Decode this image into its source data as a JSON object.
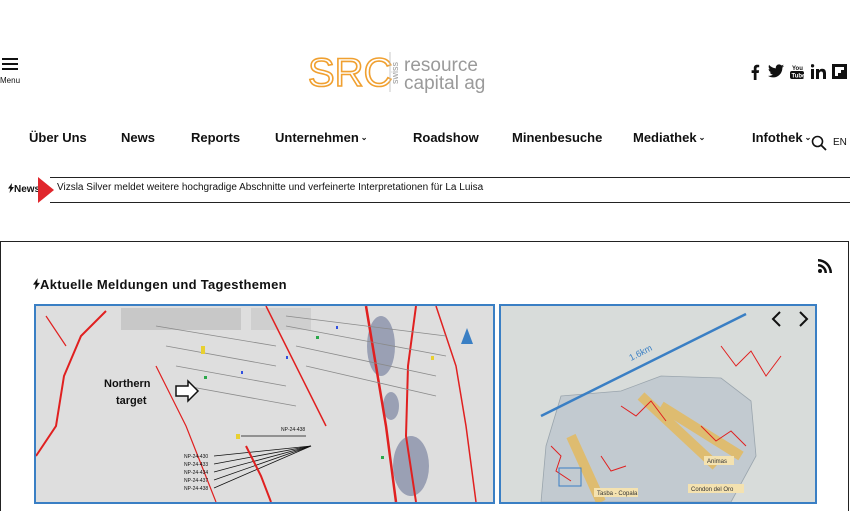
{
  "header": {
    "menu_label": "Menu",
    "logo": {
      "mark": "SRC",
      "swiss": "swiss",
      "line1": "resource",
      "line2": "capital ag"
    },
    "social": [
      "facebook-icon",
      "twitter-icon",
      "youtube-icon",
      "linkedin-icon",
      "flipboard-icon"
    ]
  },
  "nav": {
    "items": [
      {
        "label": "Über Uns",
        "has_caret": false
      },
      {
        "label": "News",
        "has_caret": false
      },
      {
        "label": "Reports",
        "has_caret": false
      },
      {
        "label": "Unternehmen",
        "has_caret": true
      },
      {
        "label": "Roadshow",
        "has_caret": false
      },
      {
        "label": "Minenbesuche",
        "has_caret": false
      },
      {
        "label": "Mediathek",
        "has_caret": true
      },
      {
        "label": "Infothek",
        "has_caret": true
      }
    ],
    "lang": "EN"
  },
  "ticker": {
    "label": "News",
    "headline": "Vizsla Silver meldet weitere hochgradige Abschnitte und verfeinerte Interpretationen für La Luisa"
  },
  "main": {
    "section_title": "Aktuelle Meldungen und Tagesthemen",
    "card1": {
      "target_label_1": "Northern",
      "target_label_2": "target",
      "hole_top": "NP-24-438",
      "holes": [
        "NP-24-430",
        "NP-24-433",
        "NP-24-434",
        "NP-24-437",
        "NP-24-438"
      ]
    },
    "card2": {
      "scale_label": "1.6km",
      "label_a": "Animas",
      "label_b": "Condon del Oro",
      "label_c": "Tasba - Copala"
    }
  },
  "colors": {
    "accent_red": "#e0262c",
    "card_border": "#3a7fc4",
    "logo_orange": "#f0a030",
    "logo_gray": "#9a9a9a"
  }
}
